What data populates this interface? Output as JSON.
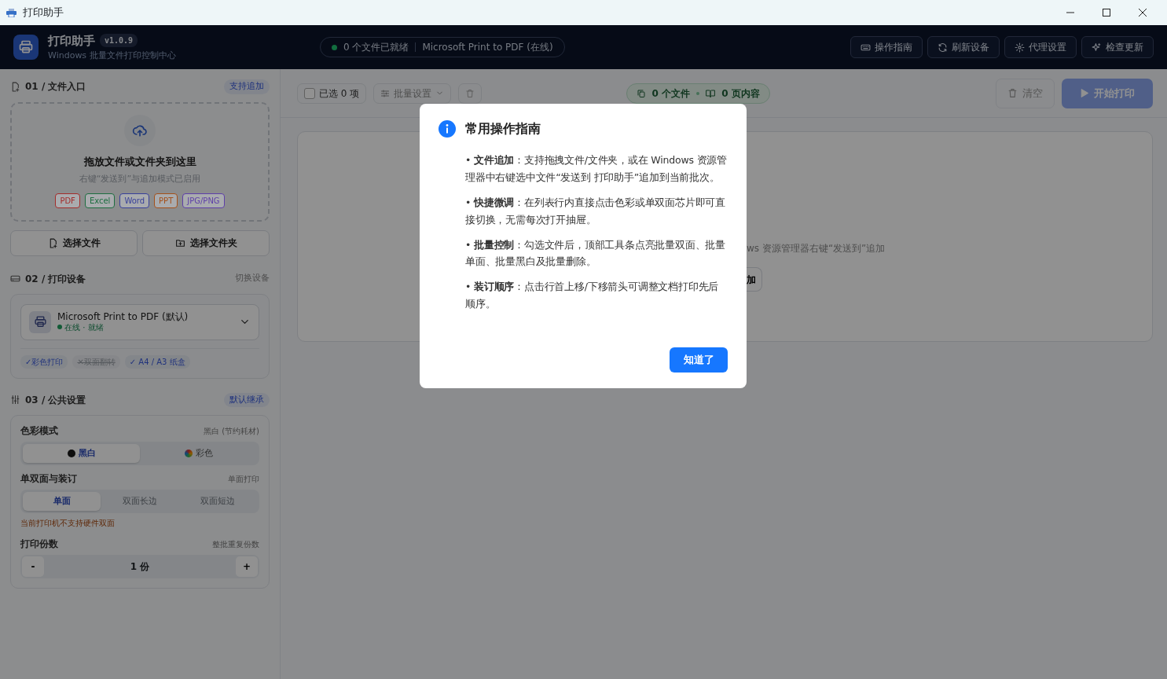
{
  "window": {
    "title": "打印助手"
  },
  "header": {
    "app_name": "打印助手",
    "version": "v1.0.9",
    "subtitle": "Windows 批量文件打印控制中心",
    "status": {
      "ready": "0 个文件已就绪",
      "printer": "Microsoft Print to PDF (在线)"
    },
    "buttons": [
      {
        "label": "操作指南",
        "kind": "keyboard"
      },
      {
        "label": "刷新设备",
        "kind": "refresh"
      },
      {
        "label": "代理设置",
        "kind": "gear"
      },
      {
        "label": "检查更新",
        "kind": "sparkle"
      }
    ]
  },
  "sidebar": {
    "files": {
      "title": "01 / 文件入口",
      "badge": "支持追加",
      "drop_title": "拖放文件或文件夹到这里",
      "drop_hint": "右键“发送到”与追加模式已启用",
      "types": [
        {
          "label": "PDF",
          "color": "#a32d2b"
        },
        {
          "label": "Excel",
          "color": "#1e6e40"
        },
        {
          "label": "Word",
          "color": "#38409a"
        },
        {
          "label": "PPT",
          "color": "#a4501a"
        },
        {
          "label": "JPG/PNG",
          "color": "#5e3fa8"
        }
      ],
      "buttons": [
        {
          "label": "选择文件",
          "kind": "file"
        },
        {
          "label": "选择文件夹",
          "kind": "folder"
        }
      ]
    },
    "printer": {
      "title": "02 / 打印设备",
      "action": "切换设备",
      "name": "Microsoft Print to PDF (默认)",
      "state": "在线 · 就绪",
      "online": true,
      "features": [
        {
          "label": "✓彩色打印",
          "supported": true
        },
        {
          "label": "✕双面翻转",
          "supported": false
        },
        {
          "label": "✓ A4 / A3 纸盒",
          "supported": true
        }
      ]
    },
    "settings": {
      "title": "03 / 公共设置",
      "badge": "默认继承",
      "color_mode": {
        "label": "色彩模式",
        "hint": "黑白 (节约耗材)",
        "options": [
          {
            "label": "黑白",
            "kind": "mono",
            "selected": true
          },
          {
            "label": "彩色",
            "kind": "color",
            "selected": false
          }
        ]
      },
      "duplex": {
        "label": "单双面与装订",
        "hint": "单面打印",
        "options": [
          {
            "label": "单面",
            "selected": true,
            "disabled": false
          },
          {
            "label": "双面长边",
            "selected": false,
            "disabled": true
          },
          {
            "label": "双面短边",
            "selected": false,
            "disabled": true
          }
        ],
        "warning": "当前打印机不支持硬件双面"
      },
      "copies": {
        "label": "打印份数",
        "hint": "整批重复份数",
        "minus": "-",
        "value": "1 份",
        "plus": "+"
      }
    }
  },
  "toolbar": {
    "select_all": {
      "label": "已选 0 项",
      "checked": false
    },
    "batch": "批量设置",
    "summary": {
      "files": "0 个文件",
      "pages": "0 页内容"
    },
    "clear": "清空",
    "start": {
      "label": "开始打印",
      "disabled": true
    }
  },
  "empty_state": {
    "hint": "ws 资源管理器右键“发送到”追加",
    "button": "加"
  },
  "dialog": {
    "title": "常用操作指南",
    "items": [
      "• **文件追加**：支持拖拽文件/文件夹，或在 Windows 资源管理器中右键选中文件“发送到 打印助手”追加到当前批次。",
      "• **快捷微调**：在列表行内直接点击色彩或单双面芯片即可直接切换，无需每次打开抽屉。",
      "• **批量控制**：勾选文件后，顶部工具条点亮批量双面、批量单面、批量黑白及批量删除。",
      "• **装订顺序**：点击行首上移/下移箭头可调整文档打印先后顺序。"
    ],
    "button": "知道了"
  }
}
